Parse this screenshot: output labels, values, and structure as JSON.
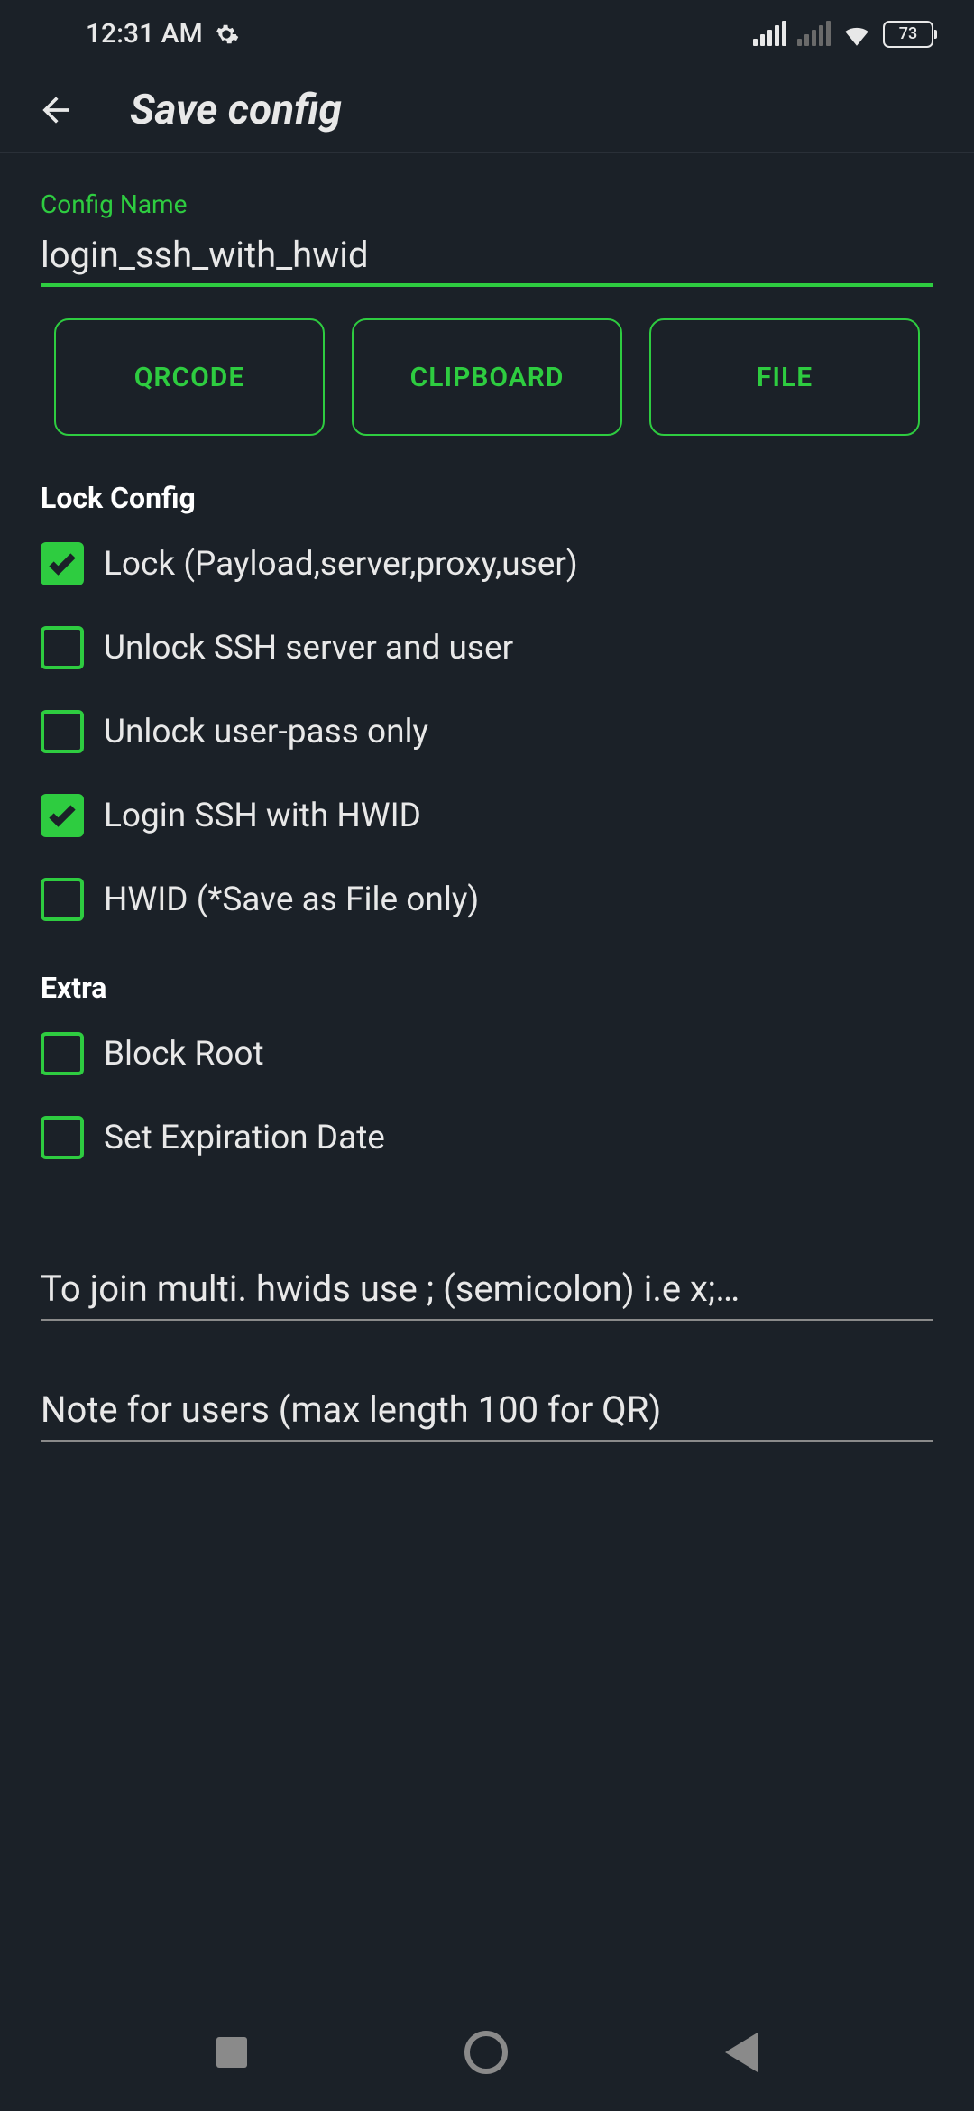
{
  "status": {
    "time": "12:31 AM",
    "battery": "73"
  },
  "header": {
    "title": "Save config"
  },
  "config_name": {
    "label": "Config Name",
    "value": "login_ssh_with_hwid"
  },
  "buttons": {
    "qrcode": "QRCODE",
    "clipboard": "CLIPBOARD",
    "file": "FILE"
  },
  "sections": {
    "lock": {
      "title": "Lock Config",
      "items": [
        {
          "label": "Lock (Payload,server,proxy,user)",
          "checked": true
        },
        {
          "label": "Unlock SSH server and user",
          "checked": false
        },
        {
          "label": "Unlock user-pass only",
          "checked": false
        },
        {
          "label": "Login SSH with HWID",
          "checked": true
        },
        {
          "label": "HWID (*Save as File only)",
          "checked": false
        }
      ]
    },
    "extra": {
      "title": "Extra",
      "items": [
        {
          "label": "Block Root",
          "checked": false
        },
        {
          "label": "Set Expiration Date",
          "checked": false
        }
      ]
    }
  },
  "inputs": {
    "hwids_placeholder": "To join multi. hwids use ; (semicolon) i.e x;…",
    "note_placeholder": "Note for users (max length 100 for QR)"
  }
}
